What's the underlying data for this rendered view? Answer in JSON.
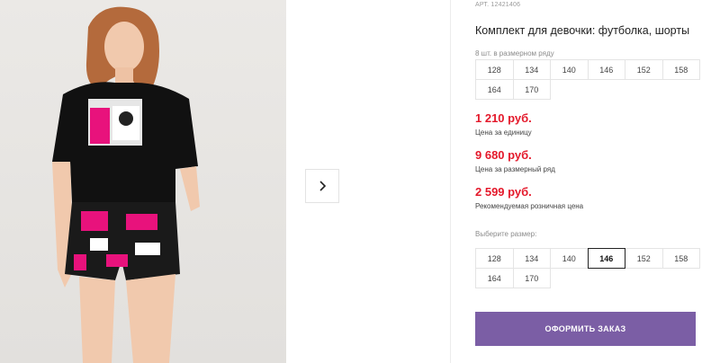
{
  "product": {
    "sku": "АРТ. 12421406",
    "title": "Комплект для девочки: футболка, шорты"
  },
  "sizes_in_row": {
    "label": "8 шт. в размерном ряду",
    "options": [
      "128",
      "134",
      "140",
      "146",
      "152",
      "158",
      "164",
      "170"
    ]
  },
  "prices": {
    "unit_price": "1 210 руб.",
    "unit_note": "Цена за единицу",
    "row_price": "9 680 руб.",
    "row_note": "Цена за размерный ряд",
    "retail_price": "2 599 руб.",
    "retail_note": "Рекомендуемая розничная цена"
  },
  "size_select": {
    "label": "Выберите размер:",
    "options": [
      "128",
      "134",
      "140",
      "146",
      "152",
      "158",
      "164",
      "170"
    ],
    "selected": "146"
  },
  "order_button": "ОФОРМИТЬ ЗАКАЗ",
  "colors": {
    "accent_price": "#e4192b",
    "button_bg": "#7b5ea5"
  },
  "icons": {
    "next": "chevron-right-icon"
  }
}
